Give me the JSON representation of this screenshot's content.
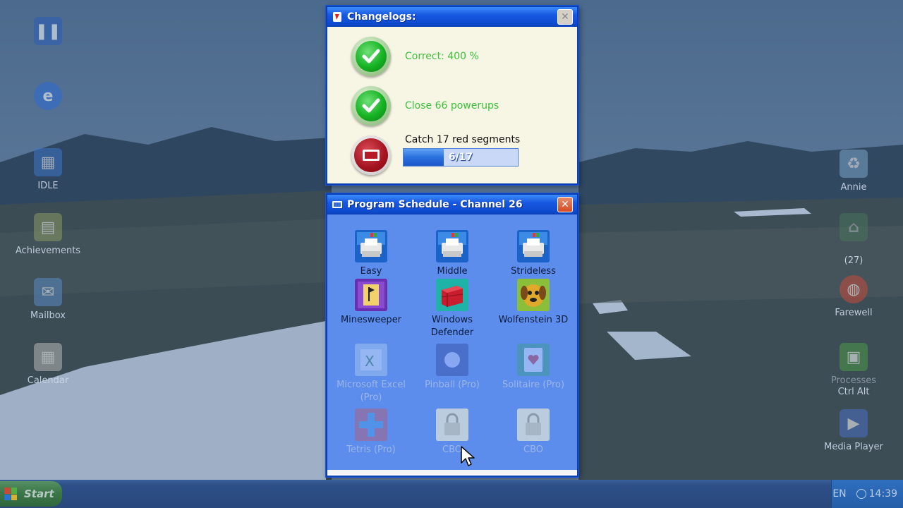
{
  "desktop": {
    "icons_left": [
      {
        "label": "",
        "icon": "pause-icon",
        "color": "#2b5db8"
      },
      {
        "label": "",
        "icon": "ie-icon",
        "color": "#2c6bd4"
      },
      {
        "label": "IDLE",
        "icon": "grid-icon",
        "color": "#3e76c9"
      },
      {
        "label": "Achievements",
        "icon": "document-icon",
        "color": "#8a9a64"
      },
      {
        "label": "Mailbox",
        "icon": "mailbox-icon",
        "color": "#5a8ac4"
      },
      {
        "label": "Calendar",
        "icon": "calendar-icon",
        "color": "#b6b6b6"
      }
    ],
    "icons_right": [
      {
        "label": "Annie",
        "icon": "recycle-bin-icon",
        "color": "#7aa6c8"
      },
      {
        "label": "",
        "sub": "(27)",
        "icon": "network-icon",
        "color": "#4f8f5f"
      },
      {
        "label": "Farewell",
        "icon": "globe-icon",
        "color": "#c84a3a"
      },
      {
        "label": "Processes",
        "sub": "Ctrl Alt",
        "icon": "task-manager-icon",
        "color": "#4a9a4a"
      },
      {
        "label": "Media Player",
        "icon": "media-player-icon",
        "color": "#4a70c4"
      }
    ]
  },
  "changelog": {
    "title": "Changelogs:",
    "tasks": [
      {
        "label": "Correct: 400 %",
        "status": "done"
      },
      {
        "label": "Close 66 powerups",
        "status": "done"
      },
      {
        "label": "Catch 17 red segments",
        "status": "in-progress",
        "current": 6,
        "total": 17,
        "progress_text": "6/17"
      }
    ]
  },
  "schedule": {
    "title": "Program Schedule - Channel 26",
    "programs": [
      {
        "label": "Easy",
        "icon": "printer-icon",
        "enabled": true
      },
      {
        "label": "Middle",
        "icon": "printer-icon",
        "enabled": true
      },
      {
        "label": "Strideless",
        "icon": "printer-icon",
        "enabled": true
      },
      {
        "label": "Minesweeper",
        "icon": "minesweeper-flag-icon",
        "enabled": true
      },
      {
        "label": "Windows Defender",
        "icon": "defender-wall-icon",
        "enabled": true
      },
      {
        "label": "Wolfenstein 3D",
        "icon": "dog-icon",
        "enabled": true
      },
      {
        "label": "Microsoft Excel (Pro)",
        "icon": "excel-icon",
        "enabled": false
      },
      {
        "label": "Pinball (Pro)",
        "icon": "pinball-icon",
        "enabled": false
      },
      {
        "label": "Solitaire (Pro)",
        "icon": "solitaire-card-icon",
        "enabled": false
      },
      {
        "label": "Tetris (Pro)",
        "icon": "tetris-icon",
        "enabled": false
      },
      {
        "label": "CBO",
        "icon": "padlock-icon",
        "enabled": false
      },
      {
        "label": "CBO",
        "icon": "padlock-icon",
        "enabled": false
      }
    ]
  },
  "taskbar": {
    "start_label": "Start",
    "language": "EN",
    "clock": "14:39"
  }
}
